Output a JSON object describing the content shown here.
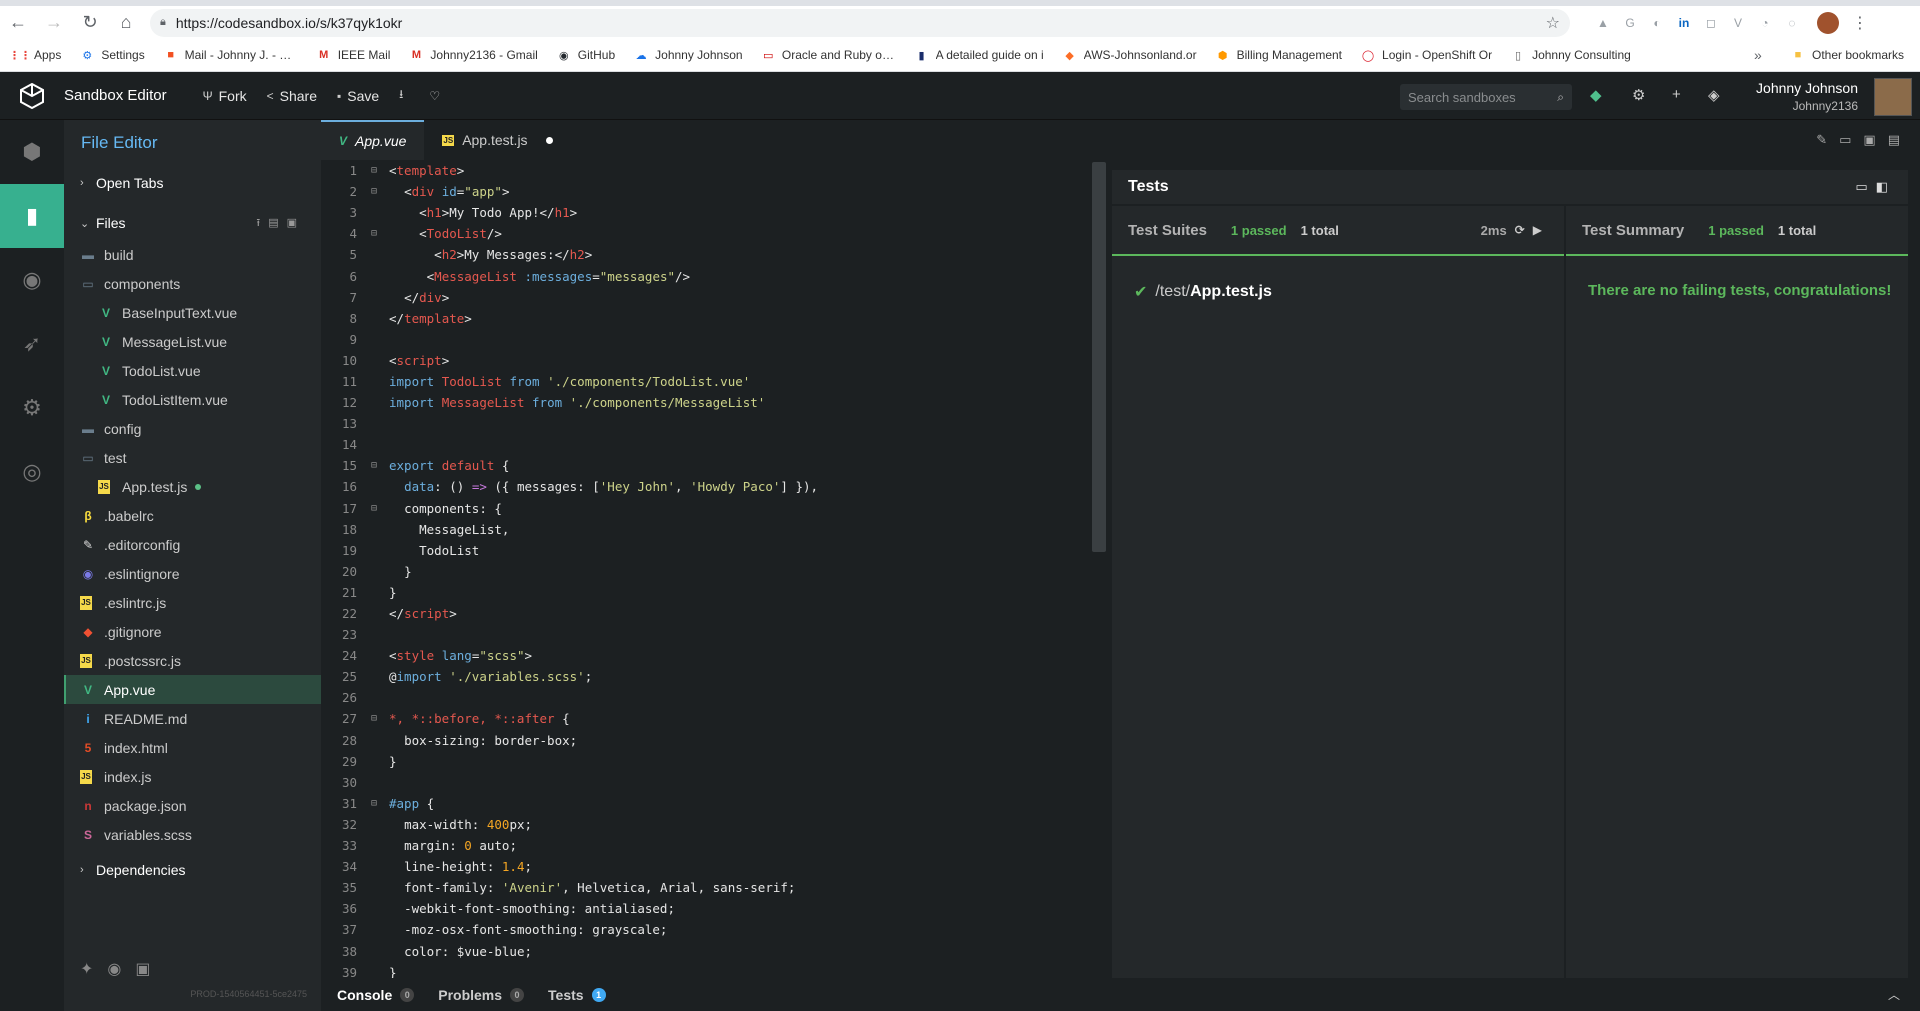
{
  "browser": {
    "url": "https://codesandbox.io/s/k37qyk1okr",
    "bookmarks": [
      {
        "label": "Apps",
        "icon": "apps-grid-icon",
        "color": "#e8453c"
      },
      {
        "label": "Settings",
        "icon": "gear-icon",
        "color": "#1a73e8"
      },
      {
        "label": "Mail - Johnny J. - Out",
        "icon": "microsoft-icon",
        "color": "#f25022"
      },
      {
        "label": "IEEE Mail",
        "icon": "gmail-icon",
        "color": "#d93025"
      },
      {
        "label": "Johnny2136 - Gmail",
        "icon": "gmail-icon",
        "color": "#d93025"
      },
      {
        "label": "GitHub",
        "icon": "github-icon",
        "color": "#24292e"
      },
      {
        "label": "Johnny Johnson",
        "icon": "cloud-icon",
        "color": "#1a73e8"
      },
      {
        "label": "Oracle and Ruby on R",
        "icon": "oracle-icon",
        "color": "#c00"
      },
      {
        "label": "A detailed guide on i",
        "icon": "stack-icon",
        "color": "#1a2d6b"
      },
      {
        "label": "AWS-Johnsonland.or",
        "icon": "gitlab-icon",
        "color": "#fc6d26"
      },
      {
        "label": "Billing Management",
        "icon": "aws-icon",
        "color": "#ff9900"
      },
      {
        "label": "Login - OpenShift Or",
        "icon": "openshift-icon",
        "color": "#db212e"
      },
      {
        "label": "Johnny Consulting",
        "icon": "page-icon",
        "color": "#666"
      }
    ],
    "bookmarks_overflow": "»",
    "other_bookmarks": "Other bookmarks"
  },
  "header": {
    "title": "Sandbox Editor",
    "fork": "Fork",
    "share": "Share",
    "save": "Save",
    "search_placeholder": "Search sandboxes",
    "user_name": "Johnny Johnson",
    "username": "Johnny2136"
  },
  "sidebar": {
    "title": "File Editor",
    "open_tabs": "Open Tabs",
    "files": "Files",
    "dependencies": "Dependencies",
    "version": "PROD-1540564451-5ce2475",
    "items": [
      {
        "name": "build",
        "type": "folder",
        "indent": 0
      },
      {
        "name": "components",
        "type": "folder-open",
        "indent": 0
      },
      {
        "name": "BaseInputText.vue",
        "type": "vue",
        "indent": 1
      },
      {
        "name": "MessageList.vue",
        "type": "vue",
        "indent": 1
      },
      {
        "name": "TodoList.vue",
        "type": "vue",
        "indent": 1
      },
      {
        "name": "TodoListItem.vue",
        "type": "vue",
        "indent": 1
      },
      {
        "name": "config",
        "type": "folder",
        "indent": 0
      },
      {
        "name": "test",
        "type": "folder-open",
        "indent": 0
      },
      {
        "name": "App.test.js",
        "type": "js",
        "indent": 1,
        "modified": true
      },
      {
        "name": ".babelrc",
        "type": "babel",
        "indent": 0
      },
      {
        "name": ".editorconfig",
        "type": "editorconfig",
        "indent": 0
      },
      {
        "name": ".eslintignore",
        "type": "eslint",
        "indent": 0
      },
      {
        "name": ".eslintrc.js",
        "type": "js",
        "indent": 0
      },
      {
        "name": ".gitignore",
        "type": "git",
        "indent": 0
      },
      {
        "name": ".postcssrc.js",
        "type": "js",
        "indent": 0
      },
      {
        "name": "App.vue",
        "type": "vue",
        "indent": 0,
        "active": true
      },
      {
        "name": "README.md",
        "type": "info",
        "indent": 0
      },
      {
        "name": "index.html",
        "type": "html",
        "indent": 0
      },
      {
        "name": "index.js",
        "type": "js",
        "indent": 0
      },
      {
        "name": "package.json",
        "type": "npm",
        "indent": 0
      },
      {
        "name": "variables.scss",
        "type": "sass",
        "indent": 0
      }
    ]
  },
  "tabs": [
    {
      "label": "App.vue",
      "type": "vue",
      "active": true
    },
    {
      "label": "App.test.js",
      "type": "js",
      "modified": true
    }
  ],
  "editor": {
    "lines": [
      {
        "n": "1",
        "f": "⊟",
        "h": "<span class='code'>&lt;</span><span class='tg'>template</span><span class='code'>&gt;</span>"
      },
      {
        "n": "2",
        "f": "⊟",
        "h": "  <span class='code'>&lt;</span><span class='tg'>div</span> <span class='at'>id</span><span class='code'>=</span><span class='st'>\"app\"</span><span class='code'>&gt;</span>"
      },
      {
        "n": "3",
        "f": "",
        "h": "    <span class='code'>&lt;</span><span class='tg'>h1</span><span class='code'>&gt;My Todo App!&lt;/</span><span class='tg'>h1</span><span class='code'>&gt;</span>"
      },
      {
        "n": "4",
        "f": "⊟",
        "h": "    <span class='code'>&lt;</span><span class='tg'>TodoList</span><span class='code'>/&gt;</span>"
      },
      {
        "n": "5",
        "f": "",
        "h": "      <span class='code'>&lt;</span><span class='tg'>h2</span><span class='code'>&gt;My Messages:&lt;/</span><span class='tg'>h2</span><span class='code'>&gt;</span>"
      },
      {
        "n": "6",
        "f": "",
        "h": "     <span class='code'>&lt;</span><span class='tg'>MessageList</span> <span class='at'>:messages</span><span class='code'>=</span><span class='st'>\"messages\"</span><span class='code'>/&gt;</span>"
      },
      {
        "n": "7",
        "f": "",
        "h": "  <span class='code'>&lt;/</span><span class='tg'>div</span><span class='code'>&gt;</span>"
      },
      {
        "n": "8",
        "f": "",
        "h": "<span class='code'>&lt;/</span><span class='tg'>template</span><span class='code'>&gt;</span>"
      },
      {
        "n": "9",
        "f": "",
        "h": ""
      },
      {
        "n": "10",
        "f": "",
        "h": "<span class='code'>&lt;</span><span class='tg'>script</span><span class='code'>&gt;</span>"
      },
      {
        "n": "11",
        "f": "",
        "h": "<span class='kw'>import</span> <span class='nm'>TodoList</span> <span class='kw'>from</span> <span class='st'>'./components/TodoList.vue'</span>"
      },
      {
        "n": "12",
        "f": "",
        "h": "<span class='kw'>import</span> <span class='nm'>MessageList</span> <span class='kw'>from</span> <span class='st'>'./components/MessageList'</span>"
      },
      {
        "n": "13",
        "f": "",
        "h": ""
      },
      {
        "n": "14",
        "f": "",
        "h": ""
      },
      {
        "n": "15",
        "f": "⊟",
        "h": "<span class='kw'>export</span> <span class='tg'>default</span> <span class='code'>{</span>"
      },
      {
        "n": "16",
        "f": "",
        "h": "  <span class='at'>data</span><span class='code'>: () </span><span class='pu'>=&gt;</span><span class='code'> ({ messages: [</span><span class='st'>'Hey John'</span><span class='code'>, </span><span class='st'>'Howdy Paco'</span><span class='code'>] }),</span>"
      },
      {
        "n": "17",
        "f": "⊟",
        "h": "  <span class='code'>components: {</span>"
      },
      {
        "n": "18",
        "f": "",
        "h": "    <span class='code'>MessageList,</span>"
      },
      {
        "n": "19",
        "f": "",
        "h": "    <span class='code'>TodoList</span>"
      },
      {
        "n": "20",
        "f": "",
        "h": "  <span class='code'>}</span>"
      },
      {
        "n": "21",
        "f": "",
        "h": "<span class='code'>}</span>"
      },
      {
        "n": "22",
        "f": "",
        "h": "<span class='code'>&lt;/</span><span class='tg'>script</span><span class='code'>&gt;</span>"
      },
      {
        "n": "23",
        "f": "",
        "h": ""
      },
      {
        "n": "24",
        "f": "",
        "h": "<span class='code'>&lt;</span><span class='tg'>style</span> <span class='at'>lang</span><span class='code'>=</span><span class='st'>\"scss\"</span><span class='code'>&gt;</span>"
      },
      {
        "n": "25",
        "f": "",
        "h": "<span class='code'>@</span><span class='kw'>import</span> <span class='st'>'./variables.scss'</span><span class='code'>;</span>"
      },
      {
        "n": "26",
        "f": "",
        "h": ""
      },
      {
        "n": "27",
        "f": "⊟",
        "h": "<span class='tg'>*, *::before, *::after</span> <span class='code'>{</span>"
      },
      {
        "n": "28",
        "f": "",
        "h": "  <span class='code'>box-sizing: border-box;</span>"
      },
      {
        "n": "29",
        "f": "",
        "h": "<span class='code'>}</span>"
      },
      {
        "n": "30",
        "f": "",
        "h": ""
      },
      {
        "n": "31",
        "f": "⊟",
        "h": "<span class='at'>#app</span> <span class='code'>{</span>"
      },
      {
        "n": "32",
        "f": "",
        "h": "  <span class='code'>max-width: </span><span class='pr'>400</span><span class='code'>px;</span>"
      },
      {
        "n": "33",
        "f": "",
        "h": "  <span class='code'>margin: </span><span class='pr'>0</span><span class='code'> auto;</span>"
      },
      {
        "n": "34",
        "f": "",
        "h": "  <span class='code'>line-height: </span><span class='pr'>1.4</span><span class='code'>;</span>"
      },
      {
        "n": "35",
        "f": "",
        "h": "  <span class='code'>font-family: </span><span class='st'>'Avenir'</span><span class='code'>, Helvetica, Arial, sans-serif;</span>"
      },
      {
        "n": "36",
        "f": "",
        "h": "  <span class='code'>-webkit-font-smoothing: antialiased;</span>"
      },
      {
        "n": "37",
        "f": "",
        "h": "  <span class='code'>-moz-osx-font-smoothing: grayscale;</span>"
      },
      {
        "n": "38",
        "f": "",
        "h": "  <span class='code'>color: $vue-blue;</span>"
      },
      {
        "n": "39",
        "f": "",
        "h": "<span class='code'>}</span>"
      }
    ]
  },
  "tests": {
    "title": "Tests",
    "suites_label": "Test Suites",
    "suites_passed": "1 passed",
    "suites_total": "1 total",
    "duration": "2ms",
    "suite_file_prefix": "/test/",
    "suite_file_name": "App.test.js",
    "summary_label": "Test Summary",
    "summary_passed": "1 passed",
    "summary_total": "1 total",
    "summary_message": "There are no failing tests, congratulations!"
  },
  "bottom": {
    "console": "Console",
    "console_count": "0",
    "problems": "Problems",
    "problems_count": "0",
    "tests": "Tests",
    "tests_count": "1"
  }
}
